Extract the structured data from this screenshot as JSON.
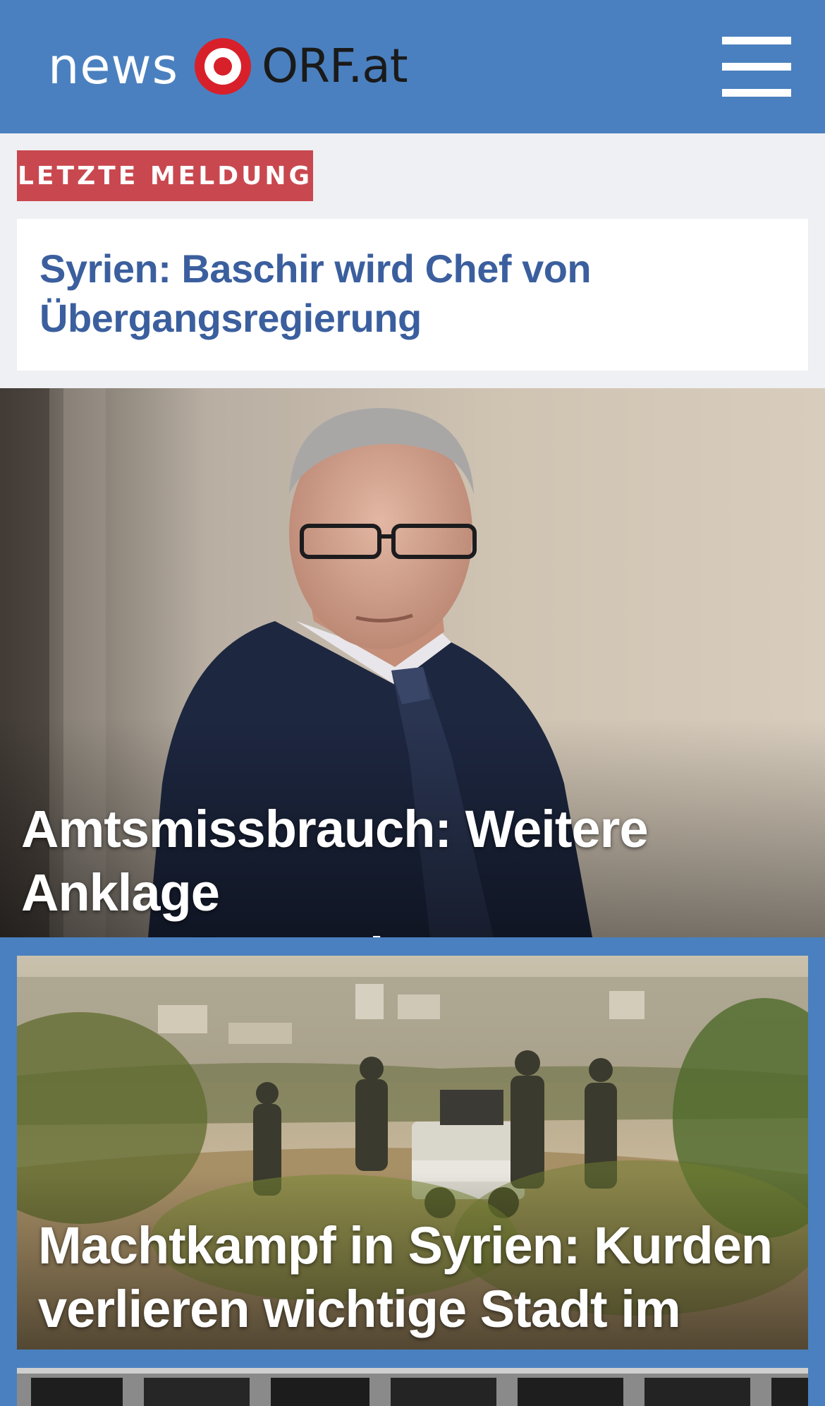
{
  "header": {
    "logo_news": "news",
    "logo_orf": "ORF.at",
    "background": "#4a80bf",
    "menu_icon": "hamburger-menu-icon"
  },
  "breaking": {
    "label": "LETZTE MELDUNG",
    "label_color": "#c9484f",
    "title_line1": "Syrien: Baschir wird Chef von",
    "title_line2": "Übergangsregierung"
  },
  "stories": [
    {
      "title_line1": "Amtsmissbrauch: Weitere Anklage",
      "title_line2": "gegen Jenewein",
      "image": "man-in-suit-photo"
    },
    {
      "title_line1": "Machtkampf in Syrien: Kurden",
      "title_line2": "verlieren wichtige Stadt im Norden",
      "image": "armed-fighters-pickup-truck-photo"
    },
    {
      "image": "building-windows-photo"
    }
  ]
}
